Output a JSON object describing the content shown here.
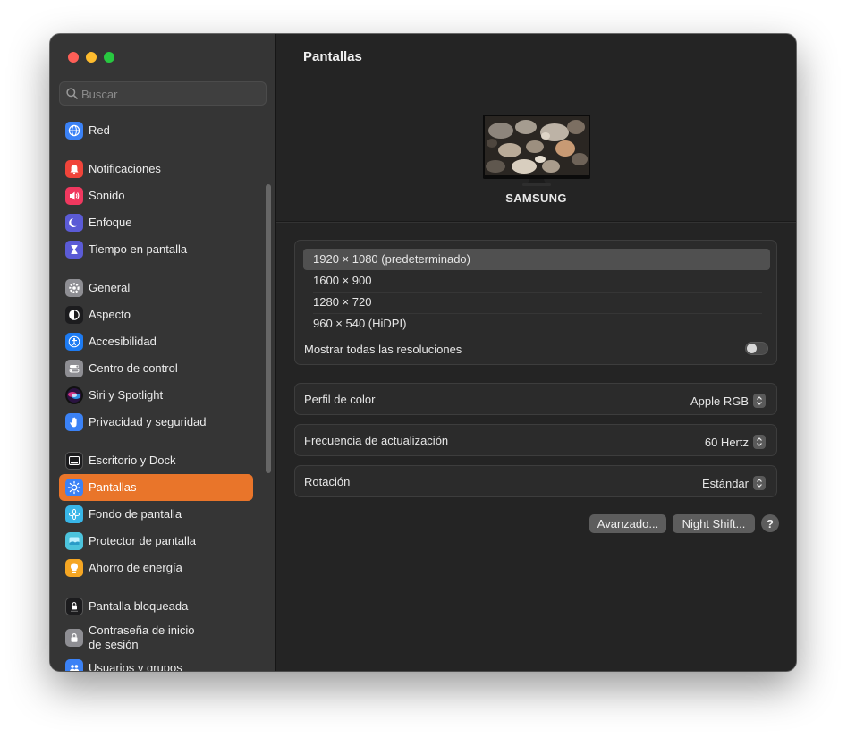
{
  "window": {
    "title": "Pantallas"
  },
  "search": {
    "placeholder": "Buscar"
  },
  "sidebar": {
    "items": [
      {
        "id": "red",
        "label": "Red",
        "icon": "globe-icon",
        "color": "#3b82f6"
      },
      {
        "id": "notificaciones",
        "label": "Notificaciones",
        "icon": "bell-icon",
        "color": "#f0443a"
      },
      {
        "id": "sonido",
        "label": "Sonido",
        "icon": "speaker-icon",
        "color": "#f0385f"
      },
      {
        "id": "enfoque",
        "label": "Enfoque",
        "icon": "moon-icon",
        "color": "#5b5bd6"
      },
      {
        "id": "tiempo",
        "label": "Tiempo en pantalla",
        "icon": "hourglass-icon",
        "color": "#5b5bd6"
      },
      {
        "id": "general",
        "label": "General",
        "icon": "gear-icon",
        "color": "#8e8e93"
      },
      {
        "id": "aspecto",
        "label": "Aspecto",
        "icon": "appearance-icon",
        "color": "#1c1c1e"
      },
      {
        "id": "accesibilidad",
        "label": "Accesibilidad",
        "icon": "accessibility-icon",
        "color": "#1d7bf2"
      },
      {
        "id": "centro",
        "label": "Centro de control",
        "icon": "control-center-icon",
        "color": "#8e8e93"
      },
      {
        "id": "siri",
        "label": "Siri y Spotlight",
        "icon": "siri-icon",
        "color": "#7a3cc9"
      },
      {
        "id": "privacidad",
        "label": "Privacidad y seguridad",
        "icon": "hand-icon",
        "color": "#3b82f6"
      },
      {
        "id": "escritorio",
        "label": "Escritorio y Dock",
        "icon": "dock-icon",
        "color": "#1c1c1e"
      },
      {
        "id": "pantallas",
        "label": "Pantallas",
        "icon": "sun-icon",
        "color": "#3b82f6"
      },
      {
        "id": "fondo",
        "label": "Fondo de pantalla",
        "icon": "flower-icon",
        "color": "#38b6e8"
      },
      {
        "id": "protector",
        "label": "Protector de pantalla",
        "icon": "screensaver-icon",
        "color": "#4cc3dc"
      },
      {
        "id": "ahorro",
        "label": "Ahorro de energía",
        "icon": "bulb-icon",
        "color": "#f5a623"
      },
      {
        "id": "bloqueada",
        "label": "Pantalla bloqueada",
        "icon": "lock-screen-icon",
        "color": "#1c1c1e"
      },
      {
        "id": "contrasena",
        "label": "Contraseña de inicio\nde sesión",
        "icon": "lock-icon",
        "color": "#8e8e93"
      },
      {
        "id": "usuarios",
        "label": "Usuarios y grupos",
        "icon": "users-icon",
        "color": "#3b82f6"
      }
    ]
  },
  "main": {
    "title": "Pantallas",
    "monitor_name": "SAMSUNG",
    "resolutions": [
      "1920 × 1080 (predeterminado)",
      "1600 × 900",
      "1280 × 720",
      "960 × 540 (HiDPI)"
    ],
    "show_all_label": "Mostrar todas las resoluciones",
    "color_profile": {
      "label": "Perfil de color",
      "value": "Apple RGB"
    },
    "refresh_rate": {
      "label": "Frecuencia de actualización",
      "value": "60 Hertz"
    },
    "rotation": {
      "label": "Rotación",
      "value": "Estándar"
    },
    "buttons": {
      "advanced": "Avanzado...",
      "night_shift": "Night Shift...",
      "help": "?"
    }
  },
  "colors": {
    "accent": "#e9752a"
  }
}
